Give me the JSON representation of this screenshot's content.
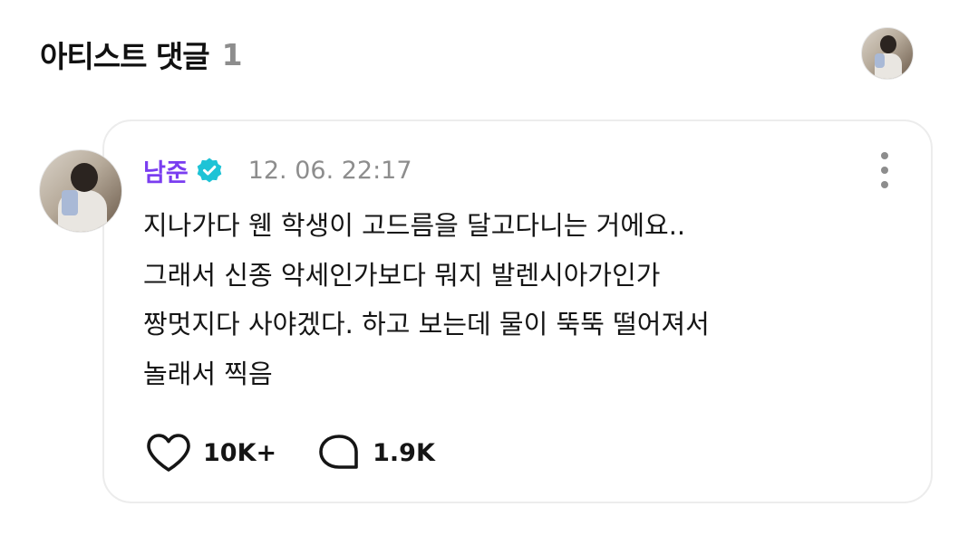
{
  "header": {
    "title": "아티스트 댓글",
    "count": "1"
  },
  "comment": {
    "author": "남준",
    "verified": true,
    "timestamp": "12. 06. 22:17",
    "text": "지나가다 웬 학생이 고드름을 달고다니는 거에요..\n그래서 신종 악세인가보다 뭐지 발렌시아가인가\n짱멋지다 사야겠다. 하고 보는데 물이 뚝뚝 떨어져서\n놀래서 찍음",
    "likes": "10K+",
    "replies": "1.9K"
  },
  "colors": {
    "author": "#7a3df0",
    "verified_badge": "#1ec3d6",
    "muted": "#8d8d8d",
    "card_border": "#ececec"
  },
  "icons": {
    "verified": "verified-badge-icon",
    "more": "more-vertical-icon",
    "like": "heart-outline-icon",
    "reply": "speech-bubble-icon"
  }
}
